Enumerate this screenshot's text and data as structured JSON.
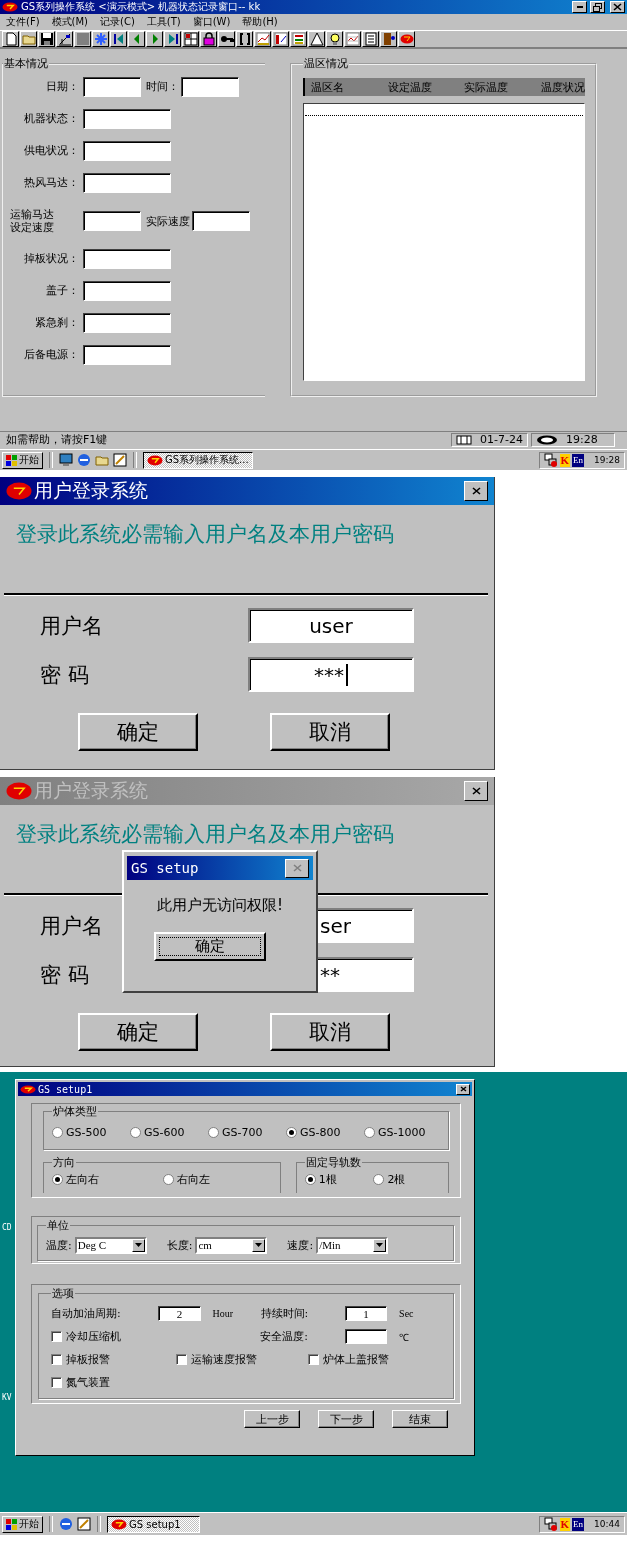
{
  "main_window": {
    "title": "GS系列操作系统 <演示模式> 机器状态记录窗口-- kk",
    "menu": [
      "文件(F)",
      "模式(M)",
      "记录(C)",
      "工具(T)",
      "窗口(W)",
      "帮助(H)"
    ],
    "basic_info": {
      "title": "基本情况",
      "rows": [
        {
          "label": "日期：",
          "second_label": "时间："
        },
        {
          "label": "机器状态："
        },
        {
          "label": "供电状况："
        },
        {
          "label": "热风马达："
        },
        {
          "label_lines": [
            "运输马达",
            "设定速度"
          ],
          "second_label": "实际速度"
        },
        {
          "label": "掉板状况："
        },
        {
          "label": "盖子："
        },
        {
          "label": "紧急刹："
        },
        {
          "label": "后备电源："
        }
      ]
    },
    "zone_panel": {
      "title": "温区情况",
      "columns": [
        "温区名",
        "设定温度",
        "实际温度",
        "温度状况"
      ]
    },
    "status_bar": {
      "help": "如需帮助，请按F1键",
      "date": "01-7-24",
      "time": "19:28"
    },
    "taskbar": {
      "start": "开始",
      "tasks": [
        {
          "label": "GS系列操作系统...",
          "selected": true
        }
      ],
      "tray": [
        "K",
        "En"
      ],
      "time": "19:28"
    }
  },
  "login_dialog": {
    "title": "用户登录系统",
    "active": true,
    "prompt": "登录此系统必需输入用户名及本用户密码",
    "fields": [
      {
        "label": "用户名",
        "value": "user"
      },
      {
        "label": "密 码",
        "value": "***",
        "focused": true
      }
    ],
    "buttons": [
      "确定",
      "取消"
    ]
  },
  "login_dialog_error": {
    "title": "用户登录系统",
    "active": false,
    "prompt": "登录此系统必需输入用户名及本用户密码",
    "fields": [
      {
        "label": "用户名",
        "value": "ser"
      },
      {
        "label": "密 码",
        "value": "**"
      }
    ],
    "buttons": [
      "确定",
      "取消"
    ],
    "message_box": {
      "title": "GS setup",
      "message": "此用户无访问权限!",
      "button": {
        "label": "确定",
        "focused": true
      }
    }
  },
  "setup": {
    "desktop_labels": [
      "CD",
      "KV"
    ],
    "title": "GS setup1",
    "furnace_type": {
      "title": "炉体类型",
      "options": [
        {
          "label": "GS-500",
          "selected": false
        },
        {
          "label": "GS-600",
          "selected": false
        },
        {
          "label": "GS-700",
          "selected": false
        },
        {
          "label": "GS-800",
          "selected": true
        },
        {
          "label": "GS-1000",
          "selected": false
        }
      ]
    },
    "direction": {
      "title": "方向",
      "options": [
        {
          "label": "左向右",
          "selected": true
        },
        {
          "label": "右向左",
          "selected": false
        }
      ]
    },
    "rails": {
      "title": "固定导轨数",
      "options": [
        {
          "label": "1根",
          "selected": true
        },
        {
          "label": "2根",
          "selected": false
        }
      ]
    },
    "units": {
      "title": "单位",
      "fields": [
        {
          "label": "温度:",
          "value": "Deg C"
        },
        {
          "label": "长度:",
          "value": "cm"
        },
        {
          "label": "速度:",
          "value": "/Min"
        }
      ]
    },
    "options": {
      "title": "选项",
      "refuel_period": {
        "label": "自动加油周期:",
        "value": "2",
        "unit": "Hour"
      },
      "duration": {
        "label": "持续时间:",
        "value": "1",
        "unit": "Sec"
      },
      "safe_temperature": {
        "label": "安全温度:",
        "unit": "℃"
      },
      "checkboxes": [
        {
          "label": "冷却压缩机",
          "checked": false
        },
        {
          "label": "掉板报警",
          "checked": false
        },
        {
          "label": "运输速度报警",
          "checked": false
        },
        {
          "label": "炉体上盖报警",
          "checked": false
        },
        {
          "label": "氮气装置",
          "checked": false
        }
      ]
    },
    "buttons": [
      "上一步",
      "下一步",
      "结束"
    ],
    "taskbar": {
      "start": "开始",
      "tasks": [
        {
          "label": "GS setup1",
          "selected": true
        }
      ],
      "tray": [
        "K",
        "En"
      ],
      "time": "10:44"
    }
  }
}
